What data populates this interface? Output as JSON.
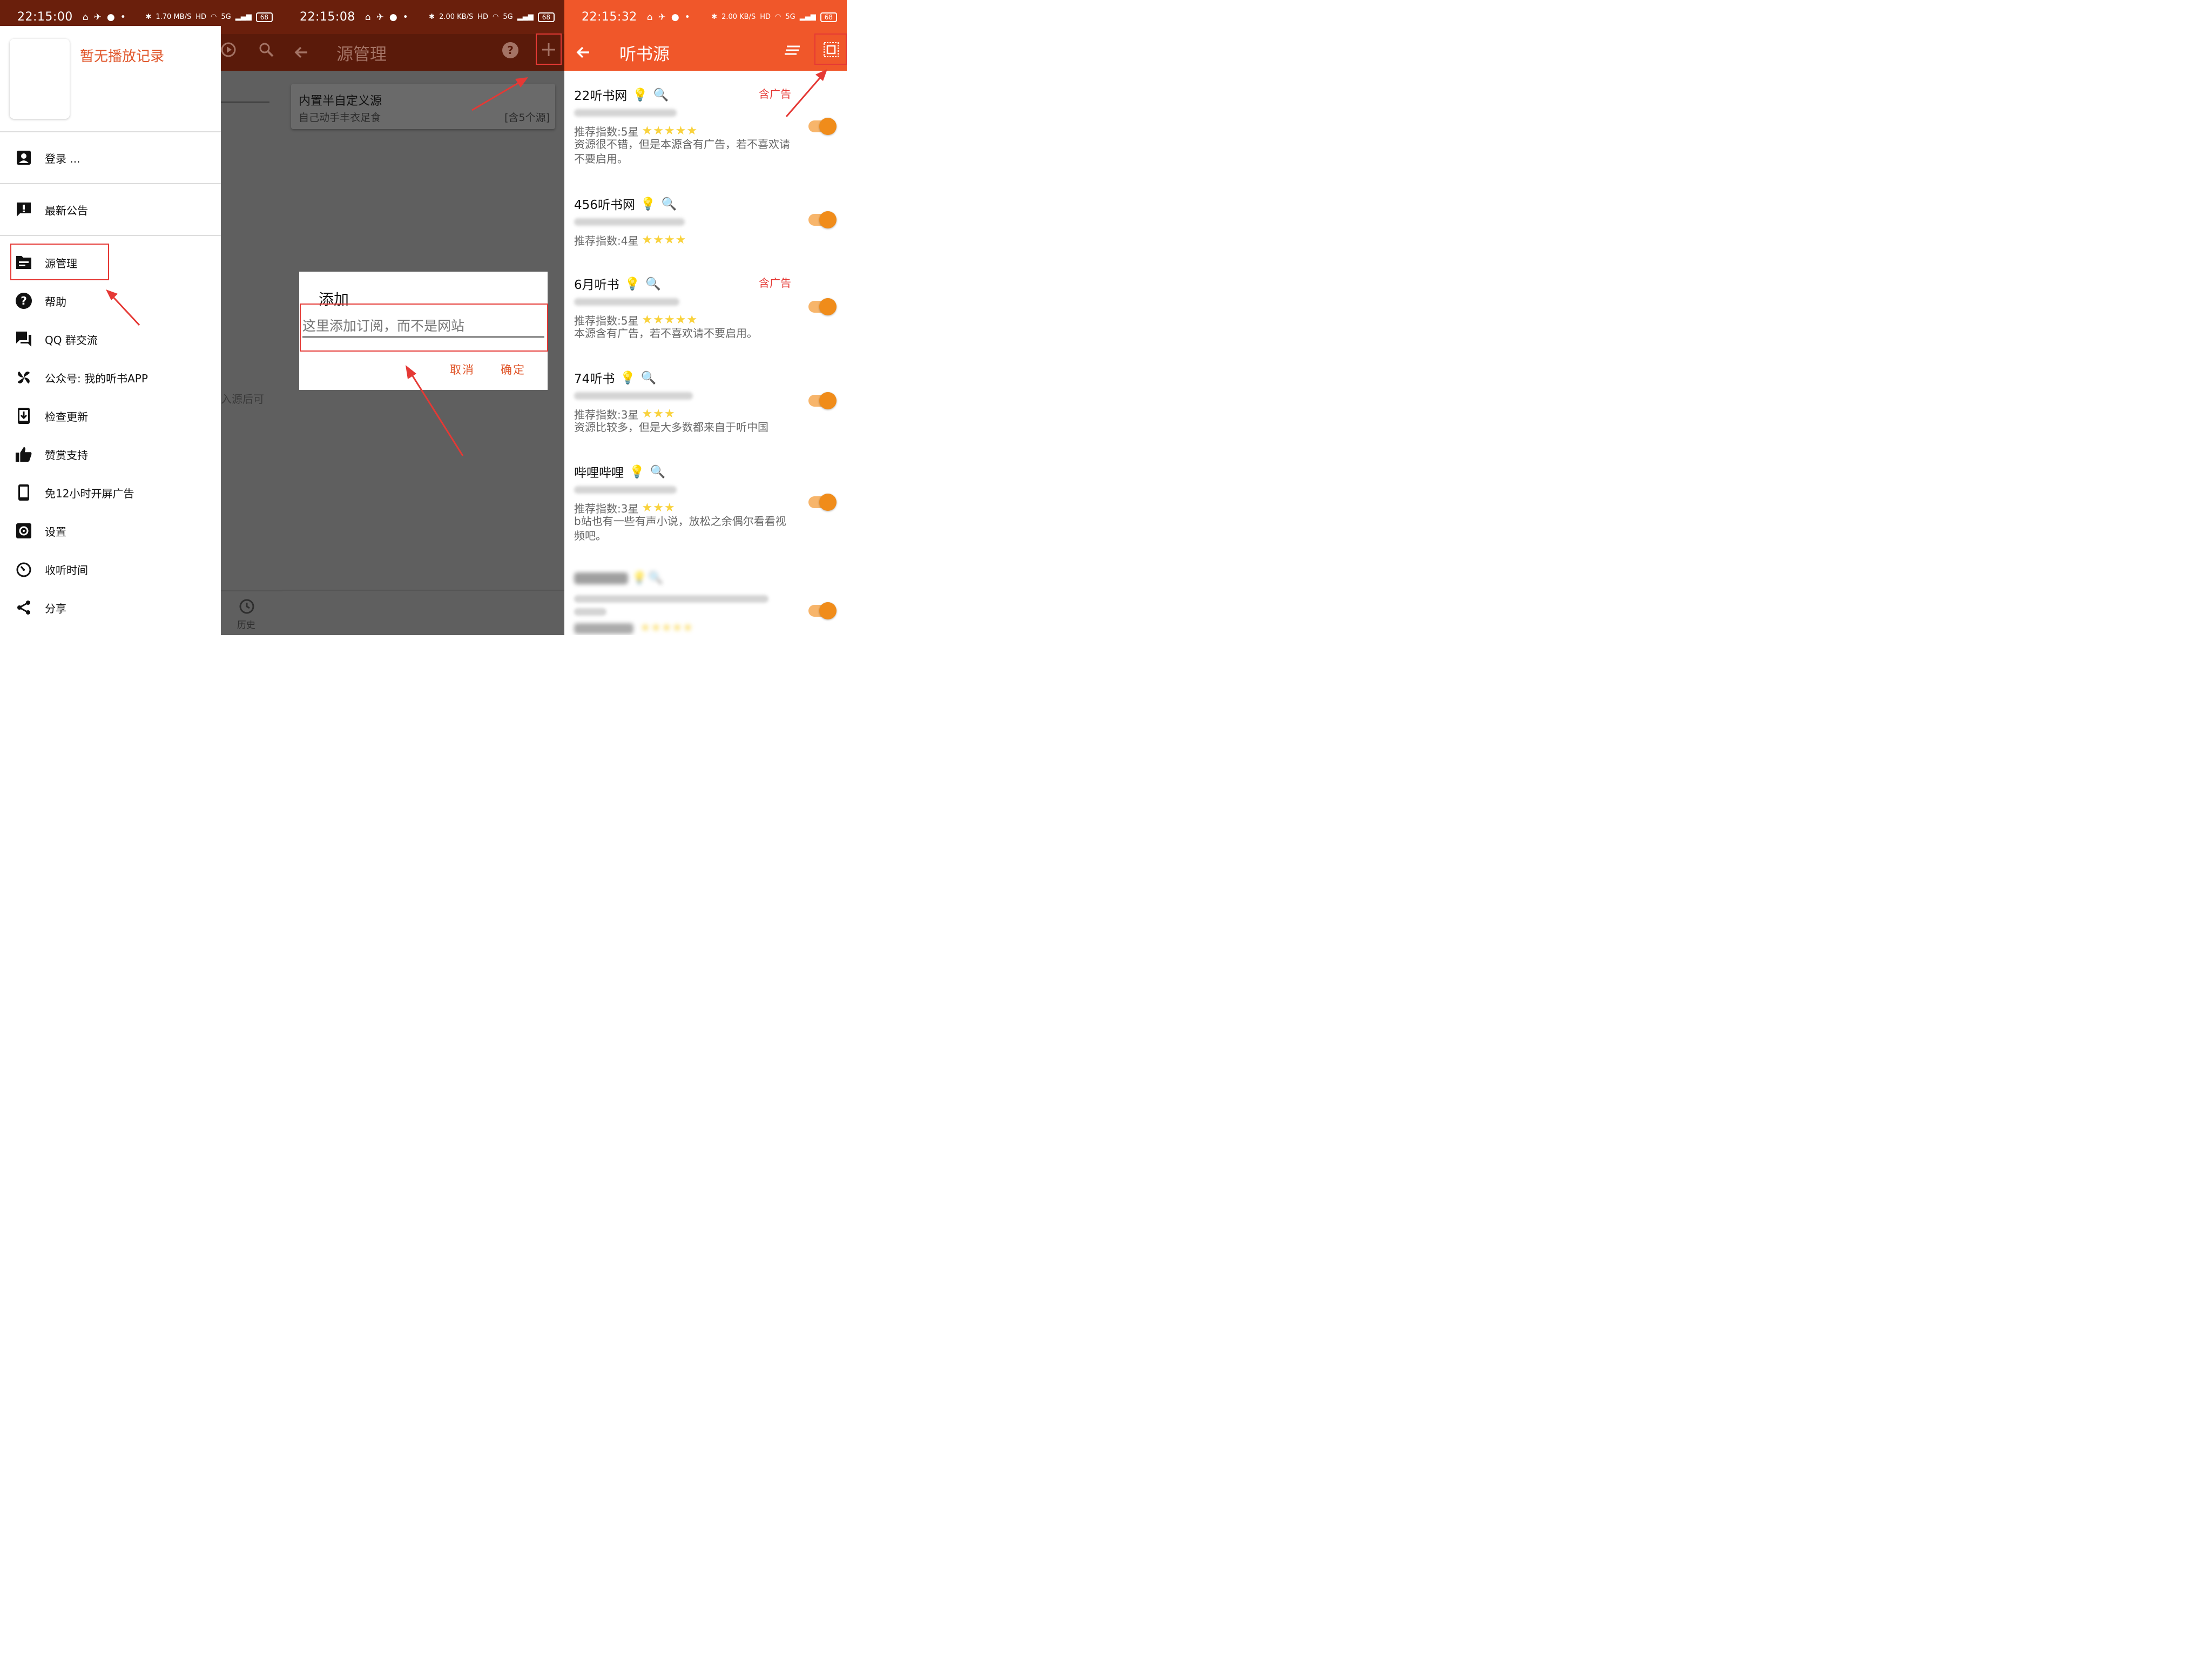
{
  "colors": {
    "accent": "#e0562a",
    "status_bar_p1": "#6a1f0c",
    "toolbar_p2": "#6a1f0c",
    "toolbar_p3": "#f0572a",
    "toggle_on": "#f08c1a",
    "ad_red": "#e53935",
    "star": "#f9d23c"
  },
  "panel1": {
    "status": {
      "time": "22:15:00",
      "speed": "1.70 MB/S",
      "hd": "HD",
      "net": "5G",
      "battery": "68"
    },
    "no_record": "暂无播放记录",
    "menu": [
      {
        "label": "登录 ...",
        "icon": "account-box-icon"
      },
      {
        "label": "最新公告",
        "icon": "announcement-icon"
      },
      {
        "label": "源管理",
        "icon": "source-folder-icon"
      },
      {
        "label": "帮助",
        "icon": "help-icon"
      },
      {
        "label": "QQ 群交流",
        "icon": "chat-icon"
      },
      {
        "label": "公众号: 我的听书APP",
        "icon": "pinwheel-icon"
      },
      {
        "label": "检查更新",
        "icon": "system-update-icon"
      },
      {
        "label": "赞赏支持",
        "icon": "thumb-up-icon"
      },
      {
        "label": "免12小时开屏广告",
        "icon": "phone-icon"
      },
      {
        "label": "设置",
        "icon": "settings-icon"
      },
      {
        "label": "收听时间",
        "icon": "timer-icon"
      },
      {
        "label": "分享",
        "icon": "share-icon"
      }
    ],
    "bg_peek": {
      "text": "入源后可",
      "history": "历史"
    }
  },
  "panel2": {
    "status": {
      "time": "22:15:08",
      "speed": "2.00 KB/S",
      "hd": "HD",
      "net": "5G",
      "battery": "68"
    },
    "title": "源管理",
    "card": {
      "title": "内置半自定义源",
      "subtitle": "自己动手丰衣足食",
      "count": "[含5个源]"
    },
    "dialog": {
      "title": "添加",
      "placeholder": "这里添加订阅，而不是网站",
      "cancel": "取消",
      "ok": "确定"
    }
  },
  "panel3": {
    "status": {
      "time": "22:15:32",
      "speed": "2.00 KB/S",
      "hd": "HD",
      "net": "5G",
      "battery": "68"
    },
    "title": "听书源",
    "sources": [
      {
        "name": "22听书网",
        "ad": "含广告",
        "rec": "推荐指数:5星",
        "stars": "★★★★★",
        "desc": "资源很不错，但是本源含有广告，若不喜欢请不要启用。",
        "enabled": true
      },
      {
        "name": "456听书网",
        "ad": "",
        "rec": "推荐指数:4星",
        "stars": "★★★★",
        "desc": "",
        "enabled": true
      },
      {
        "name": "6月听书",
        "ad": "含广告",
        "rec": "推荐指数:5星",
        "stars": "★★★★★",
        "desc": "本源含有广告，若不喜欢请不要启用。",
        "enabled": true
      },
      {
        "name": "74听书",
        "ad": "",
        "rec": "推荐指数:3星",
        "stars": "★★★",
        "desc": "资源比较多，但是大多数都来自于听中国",
        "enabled": true
      },
      {
        "name": "哔哩哔哩",
        "ad": "",
        "rec": "推荐指数:3星",
        "stars": "★★★",
        "desc": " b站也有一些有声小说，放松之余偶尔看看视频吧。",
        "enabled": true
      }
    ]
  }
}
